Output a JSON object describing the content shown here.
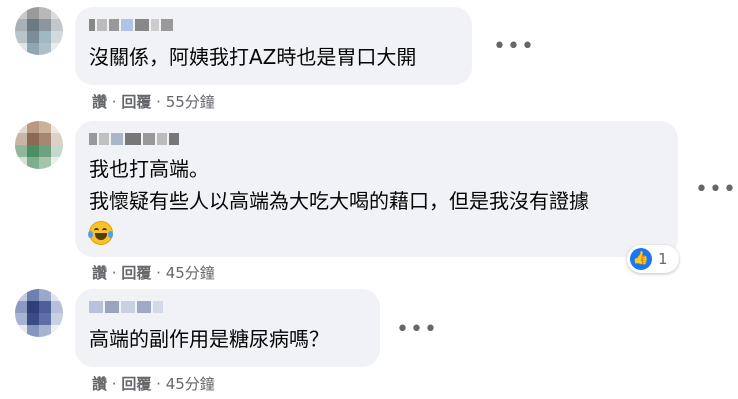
{
  "comments": [
    {
      "text_lines": [
        "沒關係，阿姨我打AZ時也是胃口大開"
      ],
      "more": "•••",
      "actions": {
        "like": "讚",
        "reply": "回覆",
        "separator": "·",
        "timestamp": "55分鐘"
      }
    },
    {
      "text_lines": [
        "我也打高端。",
        "我懷疑有些人以高端為大吃大喝的藉口，但是我沒有證據"
      ],
      "emoji": "crying-laughing-emoji",
      "more": "•••",
      "reaction": {
        "icon": "like-icon",
        "count": "1"
      },
      "actions": {
        "like": "讚",
        "reply": "回覆",
        "separator": "·",
        "timestamp": "45分鐘"
      }
    },
    {
      "text_lines": [
        "高端的副作用是糖尿病嗎？"
      ],
      "more": "•••",
      "actions": {
        "like": "讚",
        "reply": "回覆",
        "separator": "·",
        "timestamp": "45分鐘"
      }
    }
  ],
  "colors": {
    "bubble": "#f0f2f5",
    "meta": "#65676b",
    "text": "#050505",
    "like_blue": "#1877f2"
  }
}
